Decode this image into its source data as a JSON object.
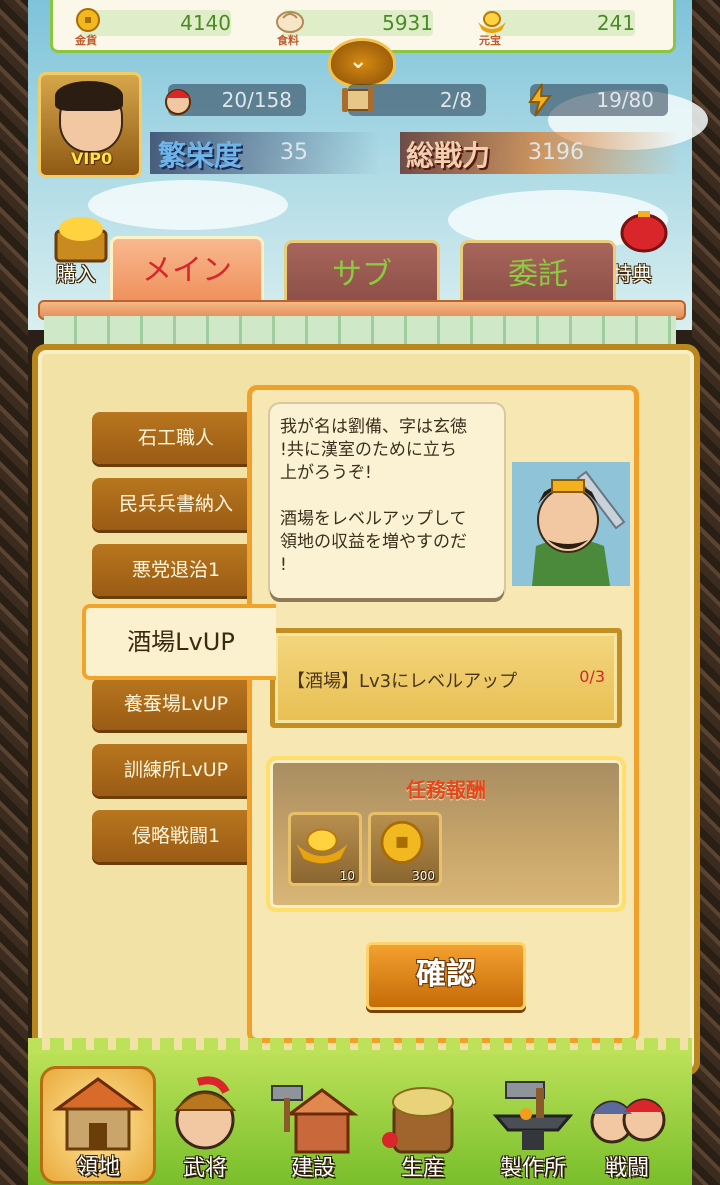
{
  "resources": [
    {
      "label": "金貨",
      "value": "4140",
      "icon": "gold-coin-icon"
    },
    {
      "label": "食料",
      "value": "5931",
      "icon": "bun-icon"
    },
    {
      "label": "元宝",
      "value": "241",
      "icon": "ingot-icon"
    }
  ],
  "player": {
    "vip": "VIP0",
    "troops": "20/158",
    "scroll": "2/8",
    "energy": "19/80",
    "prosperity_label": "繁栄度",
    "prosperity_value": "35",
    "power_label": "総戦力",
    "power_value": "3196"
  },
  "side": {
    "buy": "購入",
    "bonus": "特典"
  },
  "tabs": [
    {
      "label": "メイン",
      "active": true
    },
    {
      "label": "サブ",
      "active": false
    },
    {
      "label": "委託",
      "active": false
    }
  ],
  "quests": [
    "石工職人",
    "民兵兵書納入",
    "悪党退治1",
    "酒場LvUP",
    "養蚕場LvUP",
    "訓練所LvUP",
    "侵略戦闘1"
  ],
  "selected_quest": "酒場LvUP",
  "dialog": "我が名は劉備、字は玄徳\n!共に漢室のために立ち\n上がろうぞ!\n\n酒場をレベルアップして\n領地の収益を増やすのだ\n!",
  "objective": {
    "text": "【酒場】Lv3にレベルアップ",
    "progress": "0/3"
  },
  "reward": {
    "title": "任務報酬",
    "items": [
      {
        "icon": "ingot-icon",
        "count": "10"
      },
      {
        "icon": "gold-coin-icon",
        "count": "300"
      }
    ]
  },
  "confirm_label": "確認",
  "nav": [
    {
      "label": "領地",
      "icon": "territory-icon",
      "selected": true
    },
    {
      "label": "武将",
      "icon": "general-icon",
      "selected": false
    },
    {
      "label": "建設",
      "icon": "hammer-house-icon",
      "selected": false
    },
    {
      "label": "生産",
      "icon": "grain-barrel-icon",
      "selected": false
    },
    {
      "label": "製作所",
      "icon": "anvil-icon",
      "selected": false
    },
    {
      "label": "戦闘",
      "icon": "warriors-icon",
      "selected": false
    }
  ],
  "colors": {
    "accent": "#f1a129",
    "active_tab": "#d8262b",
    "inactive_tab_text": "#8ccb3f",
    "progress": "#d8262b"
  }
}
